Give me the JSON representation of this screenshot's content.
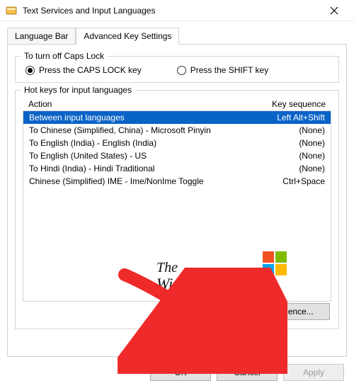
{
  "window": {
    "title": "Text Services and Input Languages"
  },
  "tabs": {
    "language_bar": "Language Bar",
    "advanced": "Advanced Key Settings"
  },
  "caps_group": {
    "label": "To turn off Caps Lock",
    "option_caps": "Press the CAPS LOCK key",
    "option_shift": "Press the SHIFT key"
  },
  "hotkeys_group": {
    "label": "Hot keys for input languages",
    "header_action": "Action",
    "header_keyseq": "Key sequence",
    "rows": [
      {
        "action": "Between input languages",
        "keyseq": "Left Alt+Shift"
      },
      {
        "action": "To Chinese (Simplified, China) - Microsoft Pinyin",
        "keyseq": "(None)"
      },
      {
        "action": "To English (India) - English (India)",
        "keyseq": "(None)"
      },
      {
        "action": "To English (United States) - US",
        "keyseq": "(None)"
      },
      {
        "action": "To Hindi (India) - Hindi Traditional",
        "keyseq": "(None)"
      },
      {
        "action": "Chinese (Simplified) IME - Ime/NonIme Toggle",
        "keyseq": "Ctrl+Space"
      }
    ],
    "change_button": "Change Key Sequence..."
  },
  "buttons": {
    "ok": "OK",
    "cancel": "Cancel",
    "apply": "Apply"
  },
  "watermark": {
    "line1": "The",
    "line2": "WindowsClub"
  }
}
